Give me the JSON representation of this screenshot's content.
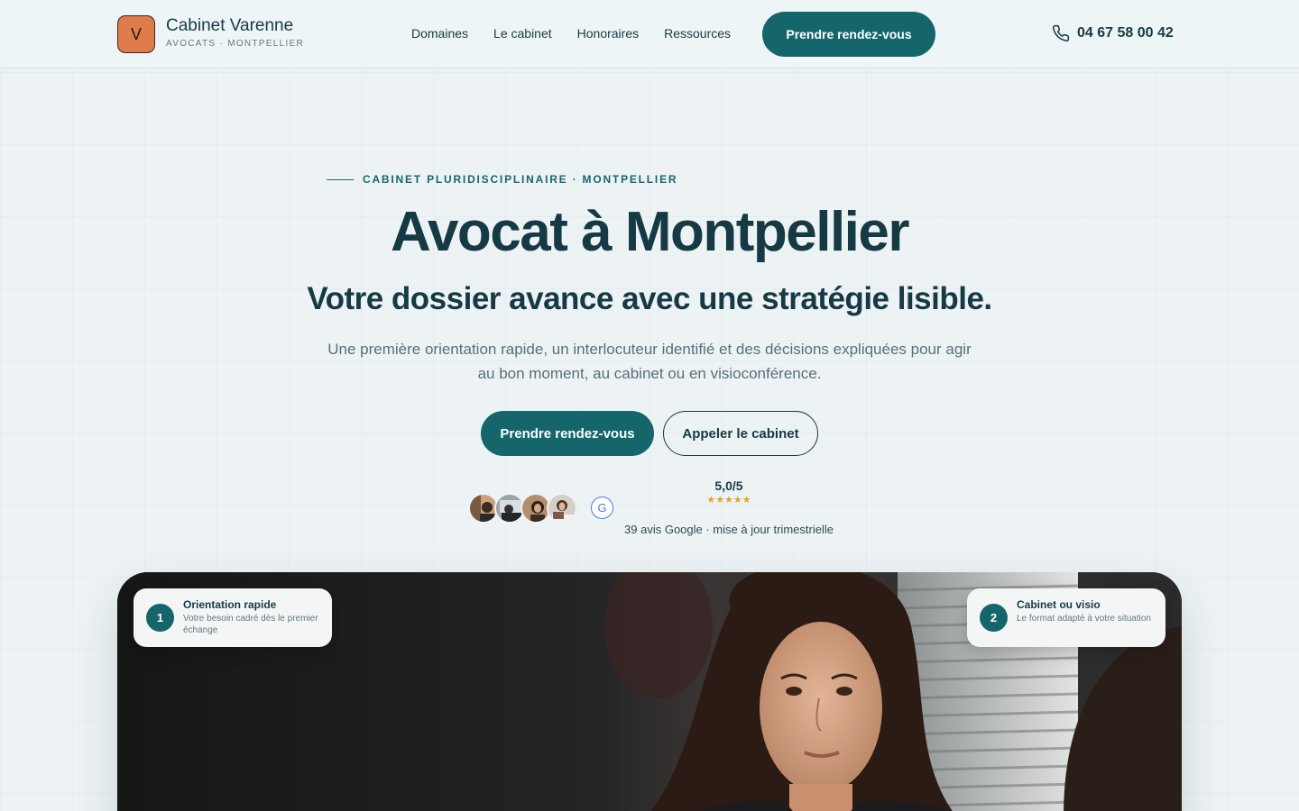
{
  "header": {
    "logo_letter": "V",
    "brand_name": "Cabinet Varenne",
    "brand_sub": "AVOCATS · MONTPELLIER",
    "nav": [
      {
        "label": "Domaines"
      },
      {
        "label": "Le cabinet"
      },
      {
        "label": "Honoraires"
      },
      {
        "label": "Ressources"
      }
    ],
    "cta_label": "Prendre rendez-vous",
    "phone_icon": "phone-icon",
    "phone_number": "04 67 58 00 42"
  },
  "hero": {
    "eyebrow": "CABINET PLURIDISCIPLINAIRE · MONTPELLIER",
    "title": "Avocat à Montpellier",
    "subtitle": "Votre dossier avance avec une stratégie lisible.",
    "lead": "Une première orientation rapide, un interlocuteur identifié et des décisions expliquées pour agir au bon moment, au cabinet ou en visioconférence.",
    "primary_cta": "Prendre rendez-vous",
    "secondary_cta": "Appeler le cabinet"
  },
  "reviews": {
    "google_letter": "G",
    "rating": "5,0/5",
    "stars": "★★★★★",
    "count_text": "39 avis Google · mise à jour trimestrielle"
  },
  "features": [
    {
      "number": "1",
      "title": "Orientation rapide",
      "description": "Votre besoin cadré dès le premier échange"
    },
    {
      "number": "2",
      "title": "Cabinet ou visio",
      "description": "Le format adapté à votre situation"
    }
  ],
  "colors": {
    "accent": "#14666a",
    "logo": "#e07b4c",
    "text": "#163a44",
    "stars": "#e0a52a"
  }
}
